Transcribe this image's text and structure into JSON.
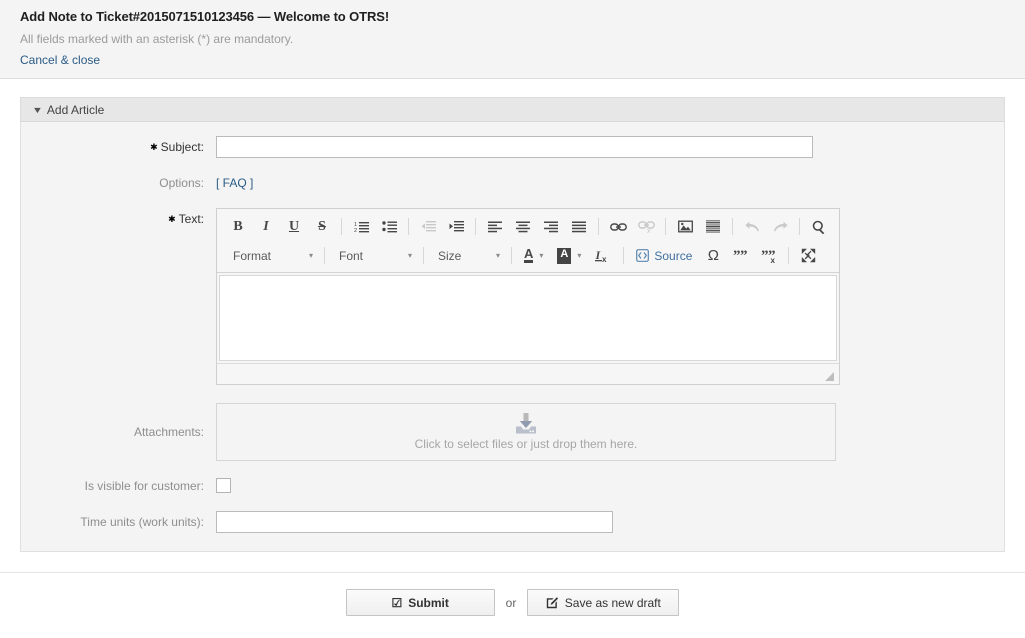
{
  "header": {
    "title": "Add Note to Ticket#2015071510123456 — Welcome to OTRS!",
    "mandatory_note": "All fields marked with an asterisk (*) are mandatory.",
    "cancel_link": "Cancel & close"
  },
  "panel": {
    "title": "Add Article",
    "twisty_glyph": "▼"
  },
  "fields": {
    "subject": {
      "label": "Subject:",
      "star": "✱",
      "value": "",
      "placeholder": ""
    },
    "options": {
      "label": "Options:",
      "faq_link": "[ FAQ ]"
    },
    "text": {
      "label": "Text:",
      "star": "✱",
      "value": ""
    },
    "attachments": {
      "label": "Attachments:",
      "dropzone_text": "Click to select files or just drop them here.",
      "dropzone_icon": "download-tray-icon"
    },
    "visible_for_customer": {
      "label": "Is visible for customer:",
      "checked": false
    },
    "time_units": {
      "label": "Time units (work units):",
      "value": "",
      "placeholder": ""
    }
  },
  "editor": {
    "toolbar_row1": [
      {
        "name": "bold",
        "glyph": "B",
        "style": "bold",
        "disabled": false
      },
      {
        "name": "italic",
        "glyph": "I",
        "style": "italic",
        "disabled": false
      },
      {
        "name": "underline",
        "glyph": "U",
        "style": "underline",
        "disabled": false
      },
      {
        "name": "strikethrough",
        "glyph": "S",
        "style": "strike",
        "disabled": false
      },
      {
        "name": "separator"
      },
      {
        "name": "numbered-list",
        "glyph": "numlist",
        "disabled": false
      },
      {
        "name": "bulleted-list",
        "glyph": "bullist",
        "disabled": false
      },
      {
        "name": "separator"
      },
      {
        "name": "outdent",
        "glyph": "outdent",
        "disabled": true
      },
      {
        "name": "indent",
        "glyph": "indent",
        "disabled": false
      },
      {
        "name": "separator"
      },
      {
        "name": "align-left",
        "glyph": "alignleft",
        "disabled": false
      },
      {
        "name": "align-center",
        "glyph": "aligncenter",
        "disabled": false
      },
      {
        "name": "align-right",
        "glyph": "alignright",
        "disabled": false
      },
      {
        "name": "justify",
        "glyph": "justify",
        "disabled": false
      },
      {
        "name": "separator"
      },
      {
        "name": "link",
        "glyph": "link",
        "disabled": false
      },
      {
        "name": "unlink",
        "glyph": "unlink",
        "disabled": true
      },
      {
        "name": "separator"
      },
      {
        "name": "image",
        "glyph": "image",
        "disabled": false
      },
      {
        "name": "horizontal-rule",
        "glyph": "hrule",
        "disabled": false
      },
      {
        "name": "separator"
      },
      {
        "name": "undo",
        "glyph": "undo",
        "disabled": true
      },
      {
        "name": "redo",
        "glyph": "redo",
        "disabled": true
      },
      {
        "name": "separator"
      },
      {
        "name": "find",
        "glyph": "find",
        "disabled": false
      }
    ],
    "combos": {
      "format": "Format",
      "font": "Font",
      "size": "Size"
    },
    "text_color_label": "A",
    "bg_color_label": "A",
    "remove_format_label": "Ix",
    "source_label": "Source",
    "special_char_glyph": "Ω",
    "insert_quote_glyph": "❞",
    "remove_quote_glyph": "❞",
    "maximize_name": "maximize",
    "caret_glyph": "▾",
    "content": ""
  },
  "footer": {
    "submit_label": "Submit",
    "submit_icon_glyph": "☑",
    "or_label": "or",
    "save_draft_label": "Save as new draft",
    "save_draft_icon": "pencil-square-icon"
  },
  "colors": {
    "link": "#2a5b86",
    "panel_header_bg": "#e7e7e7",
    "panel_body_bg": "#f4f4f4",
    "page_bg": "#ffffff",
    "muted_text": "#8e8e8e"
  }
}
